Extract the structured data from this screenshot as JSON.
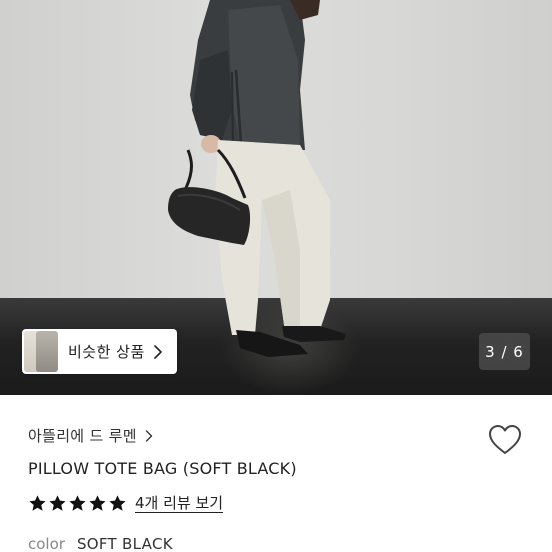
{
  "gallery": {
    "similar_label": "비슷한 상품",
    "page_indicator": "3 / 6"
  },
  "product": {
    "brand": "아뜰리에 드 루멘",
    "title": "PILLOW TOTE BAG (SOFT BLACK)",
    "rating": {
      "stars": 5,
      "max": 5,
      "review_link": "4개 리뷰 보기"
    },
    "option": {
      "key": "color",
      "value": "SOFT BLACK"
    }
  },
  "icons": {
    "chevron": "chevron-right-icon",
    "wish": "heart-icon",
    "star": "star-icon"
  },
  "colors": {
    "text": "#222222",
    "muted": "#888888",
    "star": "#111111"
  }
}
